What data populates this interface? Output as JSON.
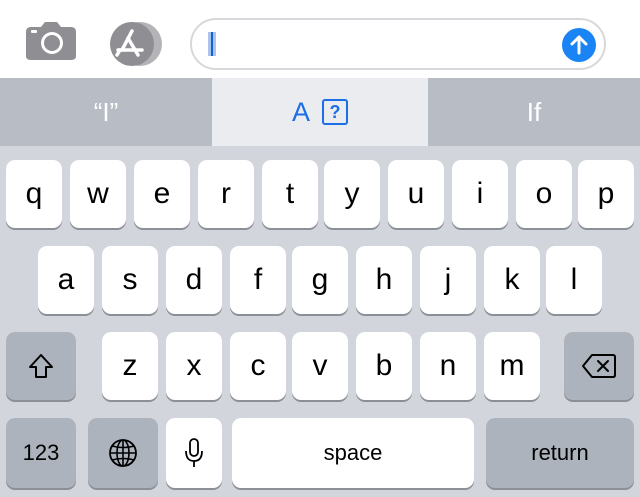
{
  "compose": {
    "text_value": "",
    "send_color": "#1a84f4",
    "camera_icon": "camera-icon",
    "appstore_icon": "app-store-icon"
  },
  "predictions": {
    "left": "“I”",
    "middle_letter": "A",
    "middle_emoji_label": "?",
    "right": "If"
  },
  "keyboard": {
    "row1": [
      "q",
      "w",
      "e",
      "r",
      "t",
      "y",
      "u",
      "i",
      "o",
      "p"
    ],
    "row2": [
      "a",
      "s",
      "d",
      "f",
      "g",
      "h",
      "j",
      "k",
      "l"
    ],
    "row3": [
      "z",
      "x",
      "c",
      "v",
      "b",
      "n",
      "m"
    ],
    "numbers_label": "123",
    "space_label": "space",
    "return_label": "return"
  }
}
